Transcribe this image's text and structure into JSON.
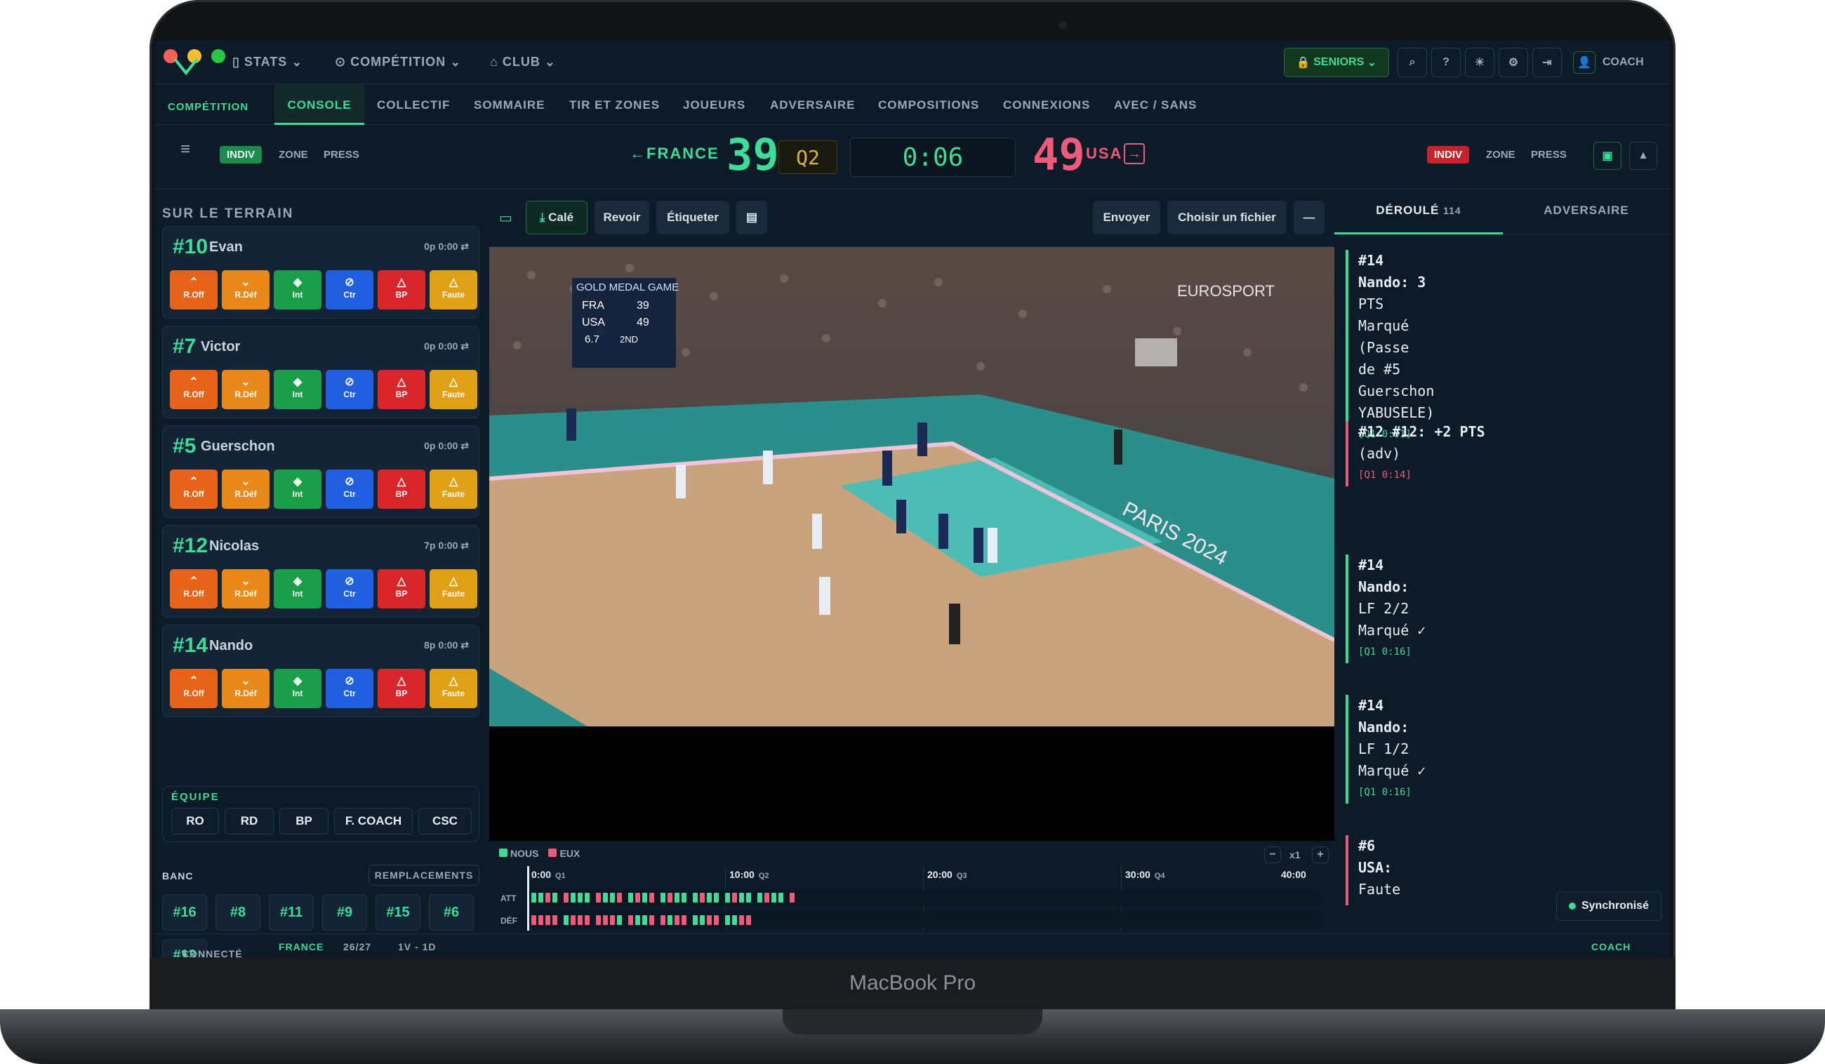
{
  "device": {
    "label": "MacBook Pro"
  },
  "topbar": {
    "nav": [
      {
        "label": "STATS"
      },
      {
        "label": "COMPÉTITION"
      },
      {
        "label": "CLUB"
      }
    ],
    "seniors_label": "SENIORS",
    "coach_label": "COACH"
  },
  "tabs": {
    "items": [
      "COMPÉTITION",
      "CONSOLE",
      "COLLECTIF",
      "SOMMAIRE",
      "TIR ET ZONES",
      "JOUEURS",
      "ADVERSAIRE",
      "COMPOSITIONS",
      "CONNEXIONS",
      "AVEC / SANS"
    ],
    "active": "CONSOLE"
  },
  "scoreboard": {
    "left_defense": [
      "INDIV",
      "ZONE",
      "PRESS"
    ],
    "right_defense": [
      "INDIV",
      "ZONE",
      "PRESS"
    ],
    "home_team": "FRANCE",
    "home_score": "39",
    "quarter": "Q2",
    "clock": "0:06",
    "away_score": "49",
    "away_team": "USA"
  },
  "court_panel": {
    "title": "SUR LE TERRAIN",
    "actions": [
      {
        "icon": "chevrons-up-icon",
        "label": "R.Off",
        "color": "#e8631a"
      },
      {
        "icon": "chevrons-down-icon",
        "label": "R.Déf",
        "color": "#e8891a"
      },
      {
        "icon": "shield-check-icon",
        "label": "Int",
        "color": "#1a9e4a"
      },
      {
        "icon": "ban-icon",
        "label": "Ctr",
        "color": "#1f5fe0"
      },
      {
        "icon": "warning-icon",
        "label": "BP",
        "color": "#d8262b"
      },
      {
        "icon": "warning-icon",
        "label": "Faute",
        "color": "#e0a016"
      }
    ],
    "players": [
      {
        "number": "#10",
        "name": "Evan",
        "points": "0p",
        "time": "0:00"
      },
      {
        "number": "#7",
        "name": "Victor",
        "points": "0p",
        "time": "0:00"
      },
      {
        "number": "#5",
        "name": "Guerschon",
        "points": "0p",
        "time": "0:00"
      },
      {
        "number": "#12",
        "name": "Nicolas",
        "points": "7p",
        "time": "0:00"
      },
      {
        "number": "#14",
        "name": "Nando",
        "points": "8p",
        "time": "0:00"
      }
    ],
    "team_title": "ÉQUIPE",
    "team_buttons": [
      "RO",
      "RD",
      "BP",
      "F. COACH",
      "CSC"
    ],
    "bench_title": "BANC",
    "replacements_label": "REMPLACEMENTS",
    "bench": [
      "#16",
      "#8",
      "#11",
      "#9",
      "#15",
      "#6",
      "#13"
    ]
  },
  "video_panel": {
    "tools": [
      "Calé",
      "Revoir",
      "Étiqueter"
    ],
    "send_label": "Envoyer",
    "file_label": "Choisir un fichier",
    "overlay": {
      "title": "GOLD MEDAL GAME",
      "rows": [
        {
          "team": "FRA",
          "score": "39"
        },
        {
          "team": "USA",
          "score": "49"
        }
      ],
      "clock": "6.7",
      "period": "2ND",
      "broadcaster": "EUROSPORT",
      "court_text": "PARIS 2024"
    }
  },
  "timeline": {
    "legend": [
      {
        "label": "NOUS",
        "color": "#3ddc97"
      },
      {
        "label": "EUX",
        "color": "#f05a7a"
      }
    ],
    "zoom": "x1",
    "ticks": [
      {
        "time": "0:00",
        "q": "Q1"
      },
      {
        "time": "10:00",
        "q": "Q2"
      },
      {
        "time": "20:00",
        "q": "Q3"
      },
      {
        "time": "30:00",
        "q": "Q4"
      },
      {
        "time": "40:00",
        "q": ""
      }
    ],
    "rows": [
      "ATT",
      "DÉF"
    ]
  },
  "events_panel": {
    "tabs": [
      {
        "label": "DÉROULÉ",
        "count": "114"
      },
      {
        "label": "ADVERSAIRE",
        "count": ""
      }
    ],
    "events": [
      {
        "lines": [
          "#14",
          "Nando: 3",
          "PTS",
          "Marqué",
          "(Passe",
          "de #5",
          "Guerschon",
          "YABUSELE)"
        ],
        "time": "[Q1 0:01]",
        "color": "#3ddc97"
      },
      {
        "lines": [
          "#12 #12: +2 PTS",
          "(adv)"
        ],
        "time": "[Q1 0:14]",
        "color": "#f05a7a"
      },
      {
        "lines": [
          "#14",
          "Nando:",
          "LF 2/2",
          "Marqué ✓"
        ],
        "time": "[Q1 0:16]",
        "color": "#3ddc97"
      },
      {
        "lines": [
          "#14",
          "Nando:",
          "LF 1/2",
          "Marqué ✓"
        ],
        "time": "[Q1 0:16]",
        "color": "#3ddc97"
      },
      {
        "lines": [
          "#6",
          "USA:",
          "Faute"
        ],
        "time": "",
        "color": "#f05a7a"
      }
    ],
    "sync_label": "Synchronisé"
  },
  "status_bar": {
    "connected": "CONNECTÉ",
    "team": "FRANCE",
    "season": "26/27",
    "format": "1V - 1D",
    "role": "COACH"
  }
}
